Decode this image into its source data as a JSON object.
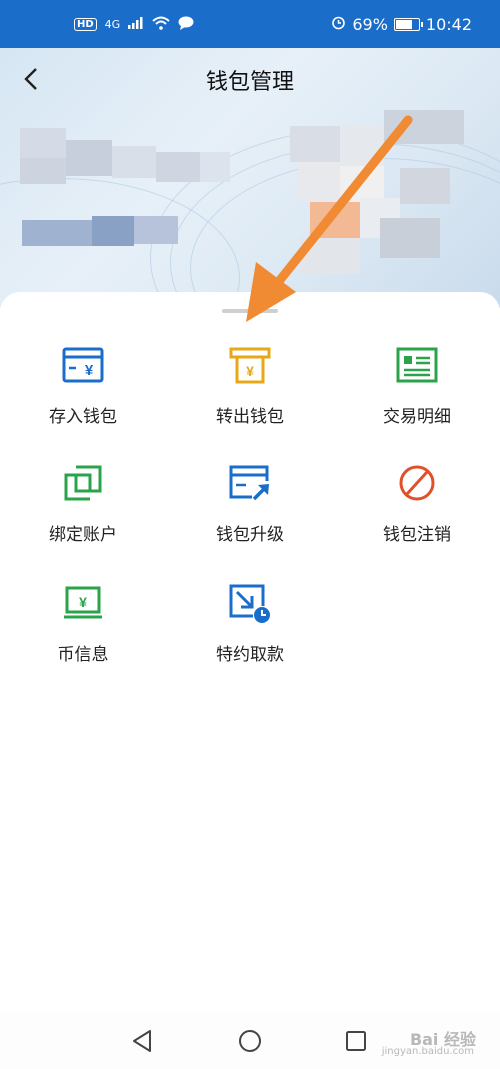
{
  "status_bar": {
    "network_badge": "HD",
    "network_type": "4G",
    "battery_percent": "69%",
    "time": "10:42"
  },
  "header": {
    "title": "钱包管理"
  },
  "menu": {
    "items": [
      {
        "label": "存入钱包",
        "icon": "deposit-wallet-icon",
        "color": "#1a6dc9"
      },
      {
        "label": "转出钱包",
        "icon": "withdraw-atm-icon",
        "color": "#e6a817"
      },
      {
        "label": "交易明细",
        "icon": "transaction-detail-icon",
        "color": "#2aa34a"
      },
      {
        "label": "绑定账户",
        "icon": "bind-account-icon",
        "color": "#2aa34a"
      },
      {
        "label": "钱包升级",
        "icon": "upgrade-card-icon",
        "color": "#1a6dc9"
      },
      {
        "label": "钱包注销",
        "icon": "cancel-prohibit-icon",
        "color": "#e0502a"
      },
      {
        "label": "币信息",
        "icon": "currency-info-icon",
        "color": "#2aa34a"
      },
      {
        "label": "特约取款",
        "icon": "special-withdraw-icon",
        "color": "#1a6dc9"
      }
    ]
  },
  "watermark": {
    "main": "Bai 经验",
    "sub": "jingyan.baidu.com"
  },
  "colors": {
    "status_bar": "#1a6dc9",
    "annotation_arrow": "#f08a33"
  }
}
